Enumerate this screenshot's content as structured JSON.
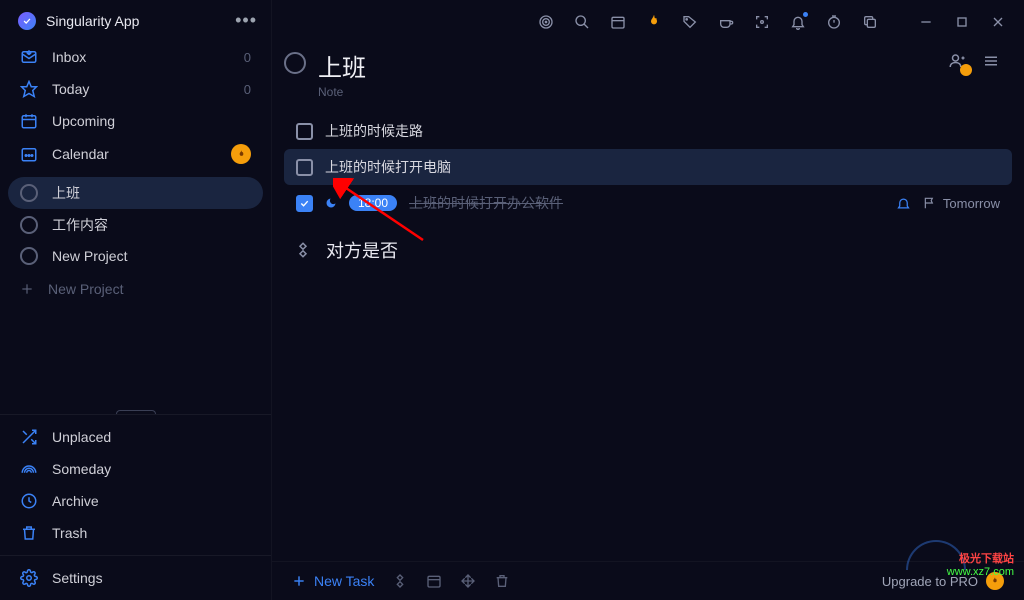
{
  "app": {
    "title": "Singularity App"
  },
  "sidebar": {
    "nav": [
      {
        "label": "Inbox",
        "count": "0"
      },
      {
        "label": "Today",
        "count": "0"
      },
      {
        "label": "Upcoming"
      },
      {
        "label": "Calendar"
      }
    ],
    "projects": [
      {
        "label": "上班"
      },
      {
        "label": "工作内容"
      },
      {
        "label": "New Project"
      }
    ],
    "newProject": "New Project",
    "bottom": [
      {
        "label": "Unplaced"
      },
      {
        "label": "Someday"
      },
      {
        "label": "Archive"
      },
      {
        "label": "Trash"
      }
    ],
    "settings": "Settings"
  },
  "content": {
    "title": "上班",
    "note": "Note",
    "tasks": [
      {
        "title": "上班的时候走路",
        "done": false,
        "highlighted": false
      },
      {
        "title": "上班的时候打开电脑",
        "done": false,
        "highlighted": true
      },
      {
        "title": "上班的时候打开办公软件",
        "done": true,
        "time": "18:00",
        "flag": "Tomorrow"
      }
    ],
    "section": "对方是否"
  },
  "bottomBar": {
    "newTask": "New Task",
    "upgrade": "Upgrade to PRO"
  },
  "watermark": {
    "line1": "极光下载站",
    "line2": "www.xz7.com"
  }
}
